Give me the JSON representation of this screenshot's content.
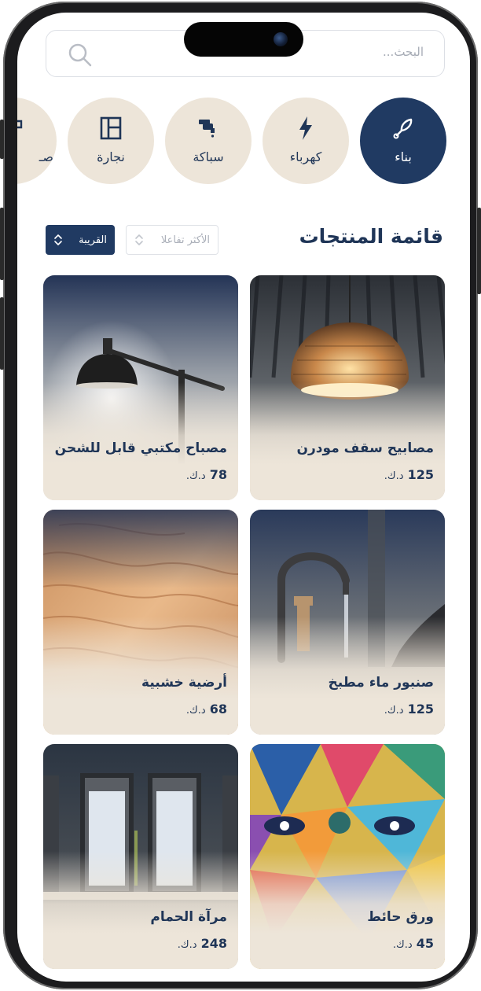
{
  "search": {
    "placeholder": "البحث..."
  },
  "categories": [
    {
      "label": "بناء",
      "icon": "trowel-icon",
      "active": true
    },
    {
      "label": "كهرباء",
      "icon": "lightning-icon",
      "active": false
    },
    {
      "label": "سباكة",
      "icon": "faucet-icon",
      "active": false
    },
    {
      "label": "نجارة",
      "icon": "window-frame-icon",
      "active": false
    },
    {
      "label": "صـ",
      "icon": "paint-roller-icon",
      "active": false
    }
  ],
  "product_list": {
    "title": "قائمة المنتجات",
    "sort_popular_label": "الأكثر تفاعلا",
    "sort_nearest_label": "القريبة"
  },
  "products": [
    {
      "name": "مصابيح سقف مودرن",
      "price": "125",
      "currency": "د.ك.",
      "image": "pendant-lamp-photo"
    },
    {
      "name": "مصباح مكتبي قابل للشحن",
      "price": "78",
      "currency": "د.ك.",
      "image": "desk-lamp-photo"
    },
    {
      "name": "صنبور ماء مطبخ",
      "price": "125",
      "currency": "د.ك.",
      "image": "kitchen-faucet-photo"
    },
    {
      "name": "أرضية خشبية",
      "price": "68",
      "currency": "د.ك.",
      "image": "wood-floor-photo"
    },
    {
      "name": "ورق حائط",
      "price": "45",
      "currency": "د.ك.",
      "image": "wallpaper-photo"
    },
    {
      "name": "مرآة الحمام",
      "price": "248",
      "currency": "د.ك.",
      "image": "bathroom-mirror-photo"
    }
  ],
  "colors": {
    "primary": "#203a62",
    "card_background": "#ede5d9",
    "category_background": "#ede5d9"
  }
}
